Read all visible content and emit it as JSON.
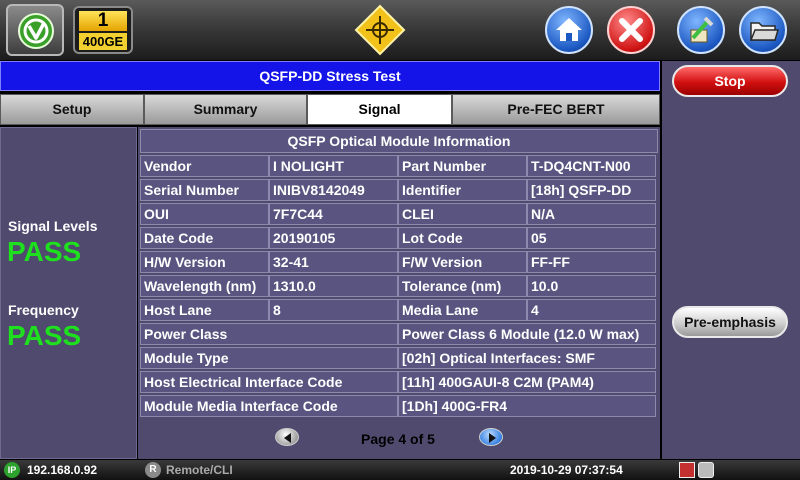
{
  "port": {
    "number": "1",
    "rate": "400GE"
  },
  "title": "QSFP-DD Stress Test",
  "tabs": [
    {
      "label": "Setup"
    },
    {
      "label": "Summary"
    },
    {
      "label": "Signal",
      "active": true
    },
    {
      "label": "Pre-FEC BERT"
    }
  ],
  "status": {
    "signal_levels_label": "Signal Levels",
    "signal_levels_value": "PASS",
    "frequency_label": "Frequency",
    "frequency_value": "PASS"
  },
  "module_info": {
    "title": "QSFP Optical Module Information",
    "rows": [
      {
        "label": "Vendor",
        "value": "I NOLIGHT",
        "label2": "Part Number",
        "value2": "T-DQ4CNT-N00"
      },
      {
        "label": "Serial Number",
        "value": "INIBV8142049",
        "label2": "Identifier",
        "value2": "[18h] QSFP-DD"
      },
      {
        "label": "OUI",
        "value": "7F7C44",
        "label2": "CLEI",
        "value2": "N/A"
      },
      {
        "label": "Date Code",
        "value": "20190105",
        "label2": "Lot Code",
        "value2": "05"
      },
      {
        "label": "H/W Version",
        "value": "32-41",
        "label2": "F/W Version",
        "value2": "FF-FF"
      },
      {
        "label": "Wavelength (nm)",
        "value": "1310.0",
        "label2": "Tolerance (nm)",
        "value2": "10.0"
      },
      {
        "label": "Host Lane",
        "value": "8",
        "label2": "Media Lane",
        "value2": "4"
      }
    ],
    "wide_rows": [
      {
        "label": "Power Class",
        "value": "Power Class 6 Module (12.0 W max)"
      },
      {
        "label": "Module Type",
        "value": "[02h] Optical Interfaces: SMF"
      },
      {
        "label": "Host Electrical Interface Code",
        "value": "[11h] 400GAUI-8 C2M (PAM4)"
      },
      {
        "label": "Module Media Interface Code",
        "value": "[1Dh] 400G-FR4"
      }
    ]
  },
  "pager": {
    "text": "Page 4 of 5"
  },
  "side_buttons": {
    "stop": "Stop",
    "pre_emphasis": "Pre-emphasis"
  },
  "statusbar": {
    "ip_badge": "IP",
    "ip": "192.168.0.92",
    "remote_badge": "R",
    "remote": "Remote/CLI",
    "datetime": "2019-10-29  07:37:54"
  },
  "colors": {
    "title_bar": "#1414e8",
    "pass": "#1ee01e",
    "panel": "#4f4a6e",
    "stop": "#d21010"
  },
  "icons": [
    "app-logo-icon",
    "crosshair-diamond-icon",
    "home-icon",
    "close-icon",
    "tools-icon",
    "folder-icon",
    "arrow-left-icon",
    "arrow-right-icon"
  ]
}
